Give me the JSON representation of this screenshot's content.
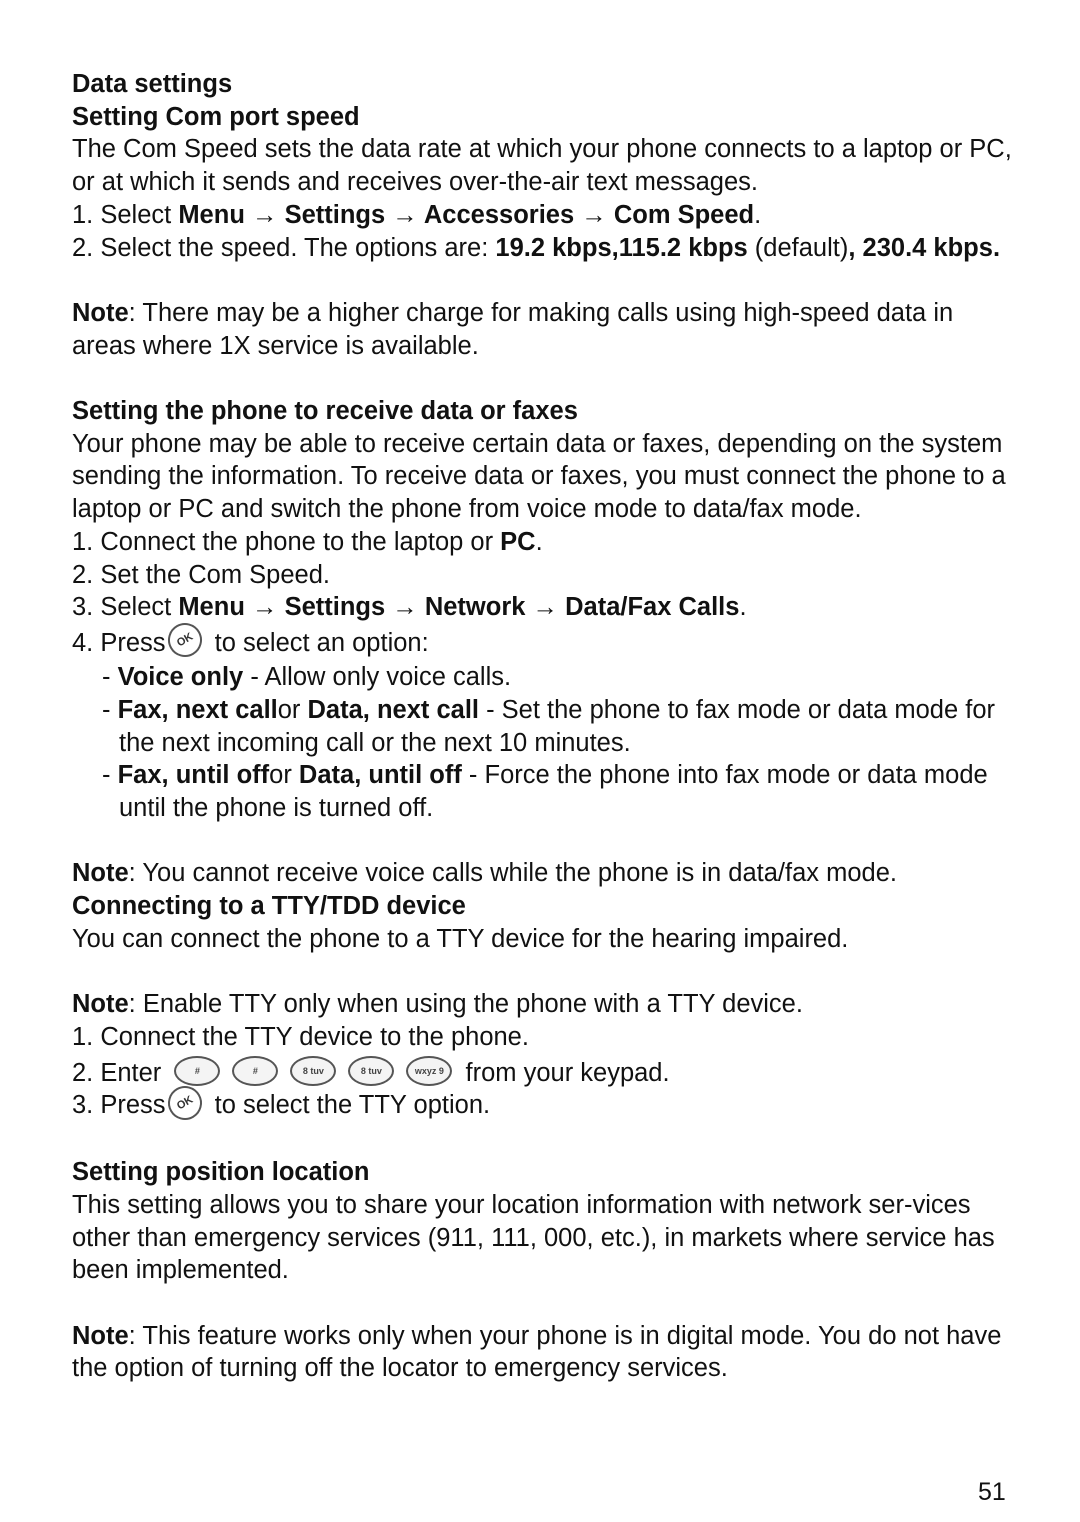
{
  "section1": {
    "title": "Data settings",
    "subtitle": "Setting Com port speed",
    "intro": "The Com Speed sets the data rate at which your phone connects to a laptop or PC, or at which it sends and receives over-the-air text messages.",
    "step1": {
      "prefix": "1. Select ",
      "menu": "Menu",
      "arrow": " → ",
      "settings": "Settings",
      "accessories": "Accessories",
      "com_speed": "Com Speed",
      "suffix": "."
    },
    "step2": {
      "prefix": "2. Select the speed. The options are: ",
      "opt1": "19.2 kbps,115.2 kbps",
      "default": " (default)",
      "opt2": ", 230.4 kbps."
    },
    "note_label": "Note",
    "note_text": ": There may be a higher charge for making calls using high-speed data in areas where 1X service is available."
  },
  "section2": {
    "title": "Setting the phone to receive data or faxes",
    "intro": "Your phone may be able to receive certain data or faxes, depending on the system sending the information. To receive data or faxes, you must connect the phone to a laptop or PC and switch the phone from voice mode to data/fax mode.",
    "step1": {
      "prefix": "1. Connect the phone to the laptop or ",
      "pc": "PC",
      "suffix": "."
    },
    "step2": "2. Set the Com Speed.",
    "step3": {
      "prefix": "3. Select ",
      "menu": "Menu",
      "arrow": " → ",
      "settings": "Settings",
      "network": "Network",
      "datafax": "Data/Fax Calls",
      "suffix": "."
    },
    "step4": {
      "prefix": "4. Press",
      "ok_key": "OK",
      "suffix": " to select an option:"
    },
    "options": [
      {
        "dash": "- ",
        "bold": "Voice only",
        "text": " - Allow only voice calls."
      },
      {
        "dash": "-  ",
        "bold1": "Fax, next call",
        "mid": "or ",
        "bold2": "Data, next call",
        "text": " - Set the phone to fax mode or data mode for the next incoming call or the next 10 minutes."
      },
      {
        "dash": "-  ",
        "bold1": "Fax, until off",
        "mid": "or ",
        "bold2": "Data, until off",
        "text": " - Force the phone into fax mode or data mode until the phone is turned off."
      }
    ],
    "note_label": "Note",
    "note_text": ": You cannot receive voice calls while the phone is in data/fax mode."
  },
  "section3": {
    "title": "Connecting to a TTY/TDD device",
    "intro": "You can connect the phone to a TTY device for the hearing impaired.",
    "note_label": "Note",
    "note_text": ": Enable TTY only when using the phone with a TTY device.",
    "step1": "1. Connect the TTY device to the phone.",
    "step2": {
      "prefix": "2. Enter",
      "keys": [
        "#",
        "#",
        "8 tuv",
        "8 tuv",
        "wxyz 9"
      ],
      "suffix": " from your keypad."
    },
    "step3": {
      "prefix": "3. Press",
      "ok_key": "OK",
      "suffix": " to select the TTY option."
    }
  },
  "section4": {
    "title": "Setting position location",
    "intro": "This setting allows you to share your location information with network ser-vices other than emergency services (911, 111, 000, etc.), in markets where service has been implemented.",
    "note_label": "Note",
    "note_text": ": This feature works only when your phone is in digital mode. You do not have the option of turning off the locator to emergency services."
  },
  "page_number": "51"
}
